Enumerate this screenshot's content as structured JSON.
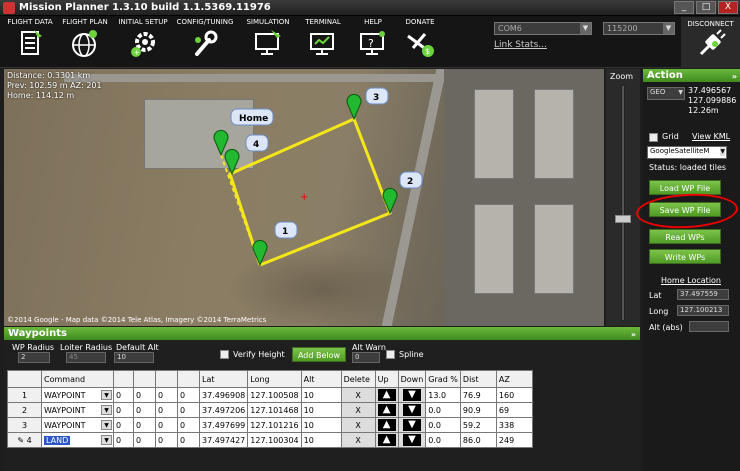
{
  "window": {
    "title": "Mission Planner 1.3.10 build 1.1.5369.11976",
    "minimize": "_",
    "maximize": "□",
    "close": "X"
  },
  "toolbar": {
    "flight_data": "FLIGHT DATA",
    "flight_plan": "FLIGHT PLAN",
    "initial_setup": "INITIAL SETUP",
    "config_tuning": "CONFIG/TUNING",
    "simulation": "SIMULATION",
    "terminal": "TERMINAL",
    "help": "HELP",
    "donate": "DONATE",
    "port": "COM6",
    "baud": "115200",
    "link_stats": "Link Stats...",
    "disconnect": "DISCONNECT"
  },
  "map": {
    "distance": "Distance: 0.3301 km",
    "prev": "Prev: 102.59 m AZ: 201",
    "home": "Home: 114.12 m",
    "copyright": "©2014 Google - Map data ©2014 Tele Atlas, Imagery ©2014 TerraMetrics",
    "home_label": "Home",
    "wp_labels": [
      "1",
      "2",
      "3",
      "4"
    ]
  },
  "zoom": {
    "label": "Zoom"
  },
  "action": {
    "title": "Action",
    "coord_type": "GEO",
    "lat": "37.496567",
    "lng": "127.099886",
    "alt": "12.26m",
    "grid_label": "Grid",
    "view_kml": "View KML",
    "map_type": "GoogleSatelliteM",
    "status": "Status: loaded tiles",
    "load_wp": "Load WP File",
    "save_wp": "Save WP File",
    "read_wps": "Read WPs",
    "write_wps": "Write WPs",
    "home_location": "Home Location",
    "home_lat_label": "Lat",
    "home_lat": "37.497559",
    "home_long_label": "Long",
    "home_long": "127.100213",
    "home_alt_label": "Alt (abs)",
    "home_alt": ""
  },
  "waypoints": {
    "title": "Waypoints",
    "wp_radius_label": "WP Radius",
    "wp_radius": "2",
    "loiter_radius_label": "Loiter Radius",
    "loiter_radius": "45",
    "default_alt_label": "Default Alt",
    "default_alt": "10",
    "verify_height": "Verify Height",
    "add_below": "Add Below",
    "alt_warn_label": "Alt Warn",
    "alt_warn": "0",
    "spline": "Spline",
    "columns": [
      "Command",
      "",
      "",
      "",
      "",
      "Lat",
      "Long",
      "Alt",
      "Delete",
      "Up",
      "Down",
      "Grad %",
      "Dist",
      "AZ"
    ],
    "rows": [
      {
        "num": "1",
        "cmd": "WAYPOINT",
        "p1": "0",
        "p2": "0",
        "p3": "0",
        "p4": "0",
        "lat": "37.496908",
        "lng": "127.100508",
        "alt": "10",
        "del": "X",
        "grad": "13.0",
        "dist": "76.9",
        "az": "160"
      },
      {
        "num": "2",
        "cmd": "WAYPOINT",
        "p1": "0",
        "p2": "0",
        "p3": "0",
        "p4": "0",
        "lat": "37.497206",
        "lng": "127.101468",
        "alt": "10",
        "del": "X",
        "grad": "0.0",
        "dist": "90.9",
        "az": "69"
      },
      {
        "num": "3",
        "cmd": "WAYPOINT",
        "p1": "0",
        "p2": "0",
        "p3": "0",
        "p4": "0",
        "lat": "37.497699",
        "lng": "127.101216",
        "alt": "10",
        "del": "X",
        "grad": "0.0",
        "dist": "59.2",
        "az": "338"
      },
      {
        "num": "4",
        "cmd": "LAND",
        "p1": "0",
        "p2": "0",
        "p3": "0",
        "p4": "0",
        "lat": "37.497427",
        "lng": "127.100304",
        "alt": "10",
        "del": "X",
        "grad": "0.0",
        "dist": "86.0",
        "az": "249"
      }
    ]
  },
  "colors": {
    "accent_green": "#5aa92e",
    "route_yellow": "#f5e61a",
    "marker_green": "#22b82f",
    "annotation_red": "#e00000"
  }
}
